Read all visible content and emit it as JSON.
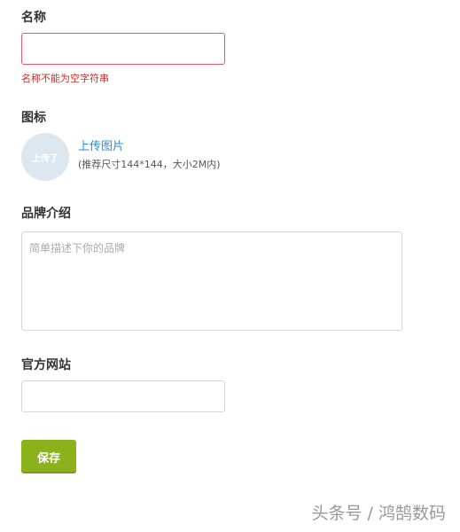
{
  "form": {
    "name": {
      "label": "名称",
      "value": "",
      "error": "名称不能为空字符串"
    },
    "icon": {
      "label": "图标",
      "thumb_text": "上传了",
      "upload_link": "上传图片",
      "hint": "(推荐尺寸144*144，大小2M内)"
    },
    "intro": {
      "label": "品牌介绍",
      "placeholder": "简单描述下你的品牌",
      "value": ""
    },
    "website": {
      "label": "官方网站",
      "value": ""
    },
    "save_label": "保存"
  },
  "watermark": "头条号 / 鸿鹄数码",
  "colors": {
    "accent": "#8bb21a",
    "link": "#2a8fd6",
    "error": "#c9302c",
    "error_border": "#e35b6b"
  }
}
